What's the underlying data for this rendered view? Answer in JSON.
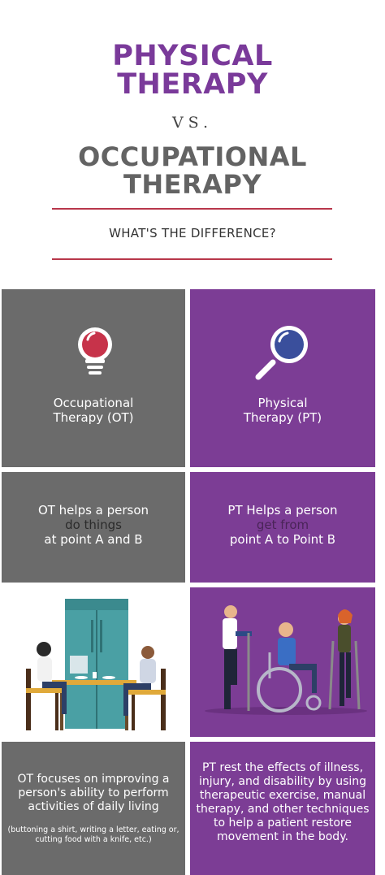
{
  "header": {
    "title_line1": "PHYSICAL",
    "title_line2": "THERAPY",
    "vs": "VS.",
    "subtitle_line1": "OCCUPATIONAL",
    "subtitle_line2": "THERAPY",
    "question": "WHAT'S THE DIFFERENCE?"
  },
  "ot": {
    "name_line1": "Occupational",
    "name_line2": "Therapy (OT)",
    "def_line1": "OT helps a person",
    "def_line2": "do things",
    "def_line3": "at point A and B",
    "focus": "OT focuses on improving a person's ability to perform activities of daily living",
    "examples": "(buttoning a shirt, writing a letter, eating or, cutting food with a knife, etc.)",
    "icon": "lightbulb-icon"
  },
  "pt": {
    "name_line1": "Physical",
    "name_line2": "Therapy (PT)",
    "def_line1": "PT Helps a person",
    "def_line2": "get from",
    "def_line3": "point A to Point B",
    "focus": "PT rest the effects of illness, injury, and disability by using therapeutic exercise, manual therapy, and other techniques to help a patient restore movement in the body.",
    "icon": "magnifying-glass-icon"
  },
  "colors": {
    "purple": "#7c3d95",
    "grey": "#6b6b6b",
    "rule": "#b8374b"
  }
}
